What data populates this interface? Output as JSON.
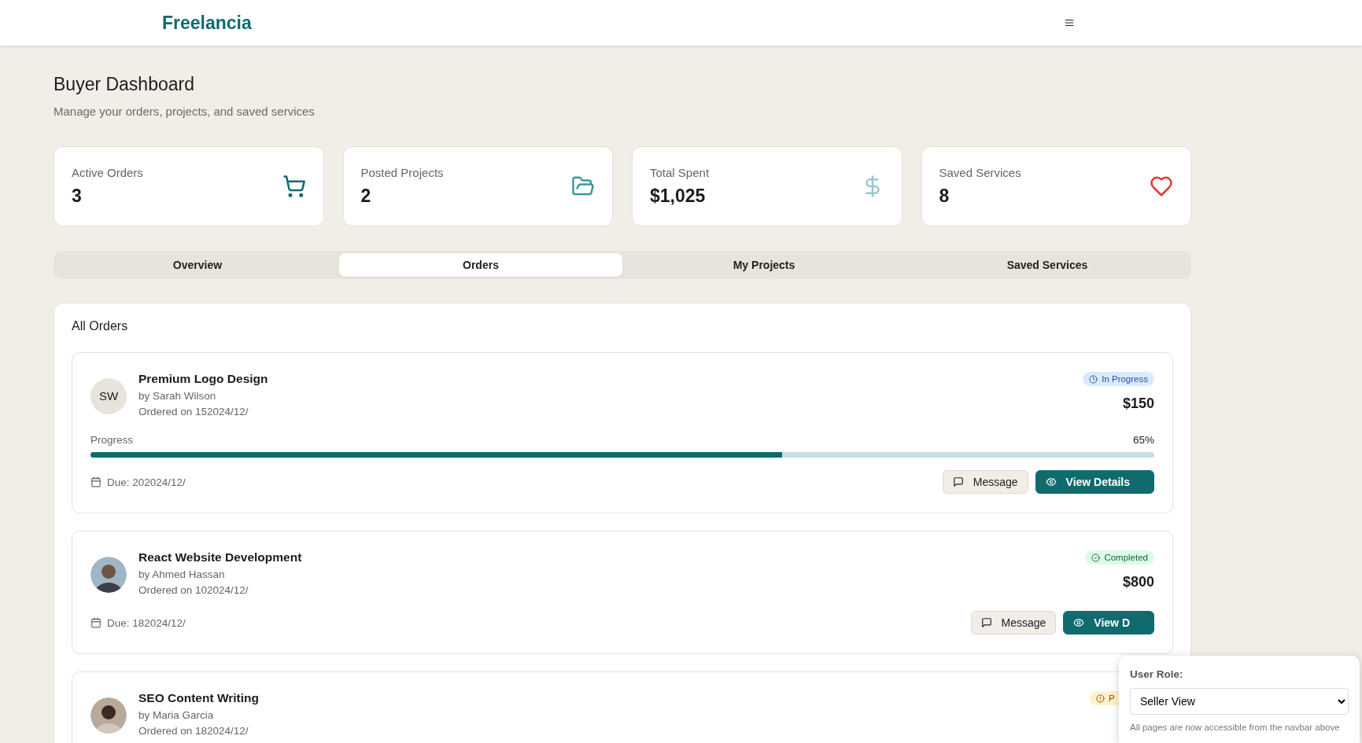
{
  "navbar": {
    "logo": "Freelancia"
  },
  "header": {
    "title": "Buyer Dashboard",
    "subtitle": "Manage your orders, projects, and saved services"
  },
  "stats": [
    {
      "label": "Active Orders",
      "value": "3",
      "kind": "cart"
    },
    {
      "label": "Posted Projects",
      "value": "2",
      "kind": "folder"
    },
    {
      "label": "Total Spent",
      "value": "$1,025",
      "kind": "dollar"
    },
    {
      "label": "Saved Services",
      "value": "8",
      "kind": "heart"
    }
  ],
  "tabs": [
    {
      "label": "Overview",
      "selected": false
    },
    {
      "label": "Orders",
      "selected": true
    },
    {
      "label": "My Projects",
      "selected": false
    },
    {
      "label": "Saved Services",
      "selected": false
    }
  ],
  "orders_panel": {
    "title": "All Orders",
    "orders": [
      {
        "title": "Premium Logo Design",
        "seller": "by Sarah Wilson",
        "ordered": "Ordered on 152024/12/",
        "avatar": {
          "kind": "initials",
          "initials": "SW"
        },
        "status": {
          "kind": "in_progress",
          "label": "In Progress"
        },
        "price": "$150",
        "progress": {
          "label": "Progress",
          "reading": "65%",
          "level": 0.65
        },
        "due": "Due: 202024/12/",
        "buttons": [
          {
            "kind": "message",
            "label": "Message"
          },
          {
            "kind": "view",
            "label": "View Details"
          }
        ]
      },
      {
        "title": "React Website Development",
        "seller": "by Ahmed Hassan",
        "ordered": "Ordered on 102024/12/",
        "avatar": {
          "kind": "picture"
        },
        "status": {
          "kind": "completed",
          "label": "Completed"
        },
        "price": "$800",
        "due": "Due: 182024/12/",
        "buttons": [
          {
            "kind": "message",
            "label": "Message"
          },
          {
            "kind": "view",
            "label": "View D"
          }
        ]
      },
      {
        "title": "SEO Content Writing",
        "seller": "by Maria Garcia",
        "ordered": "Ordered on 182024/12/",
        "avatar": {
          "kind": "picture"
        },
        "status": {
          "kind": "pending",
          "label": "P"
        }
      }
    ]
  },
  "role_panel": {
    "label": "User Role:",
    "value": "Seller View",
    "note": "All pages are now accessible from the navbar above"
  }
}
